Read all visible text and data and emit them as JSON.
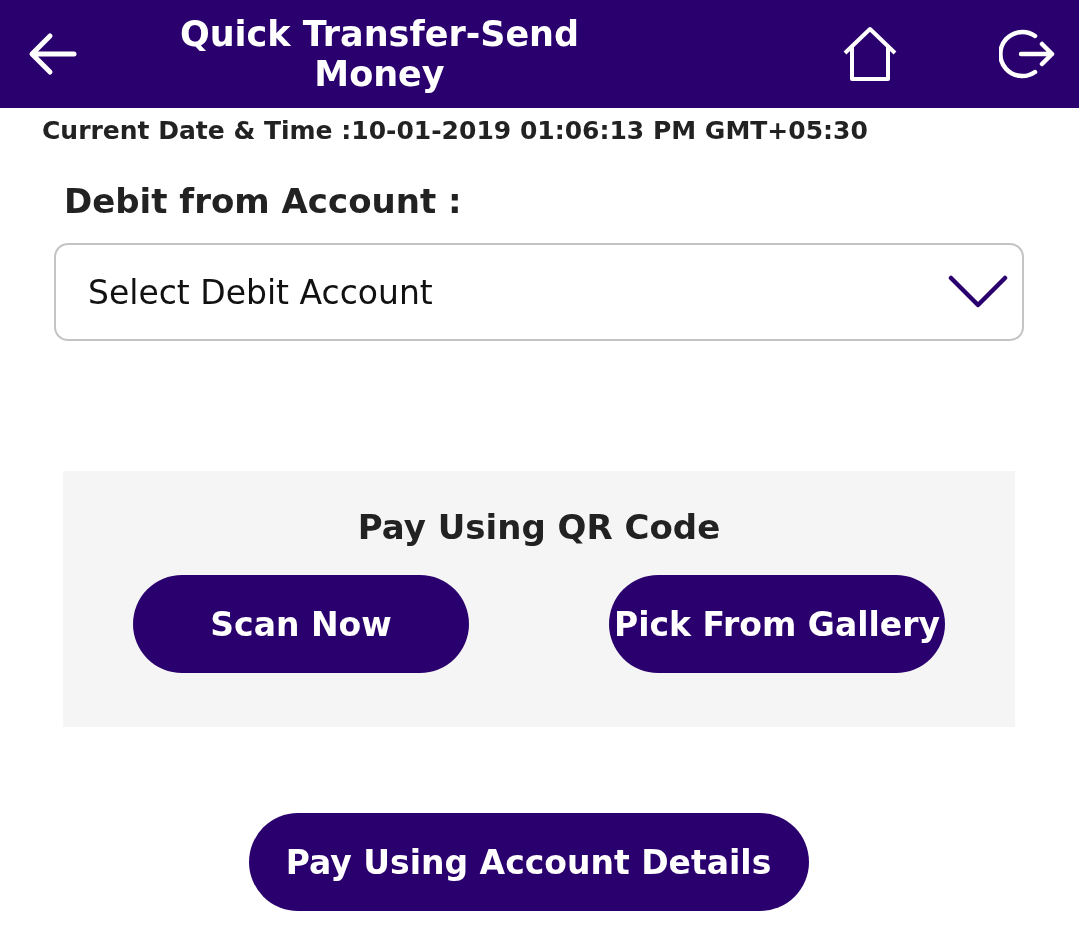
{
  "header": {
    "title": "Quick Transfer-Send Money"
  },
  "datetime": "Current Date & Time :10-01-2019 01:06:13 PM GMT+05:30",
  "debit": {
    "label": "Debit from Account :",
    "placeholder": "Select Debit Account"
  },
  "qr": {
    "title": "Pay Using QR Code",
    "buttons": [
      "Scan Now",
      "Pick From Gallery"
    ]
  },
  "account_button": "Pay Using Account Details"
}
